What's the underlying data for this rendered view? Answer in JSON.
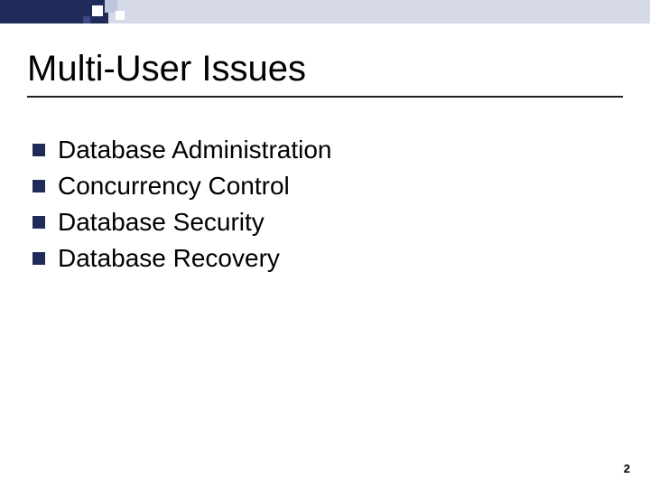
{
  "title": "Multi-User Issues",
  "bullets": [
    "Database Administration",
    "Concurrency Control",
    "Database Security",
    "Database Recovery"
  ],
  "page_number": "2",
  "colors": {
    "accent_dark": "#1f2c5a",
    "accent_light": "#d5d9e8"
  }
}
